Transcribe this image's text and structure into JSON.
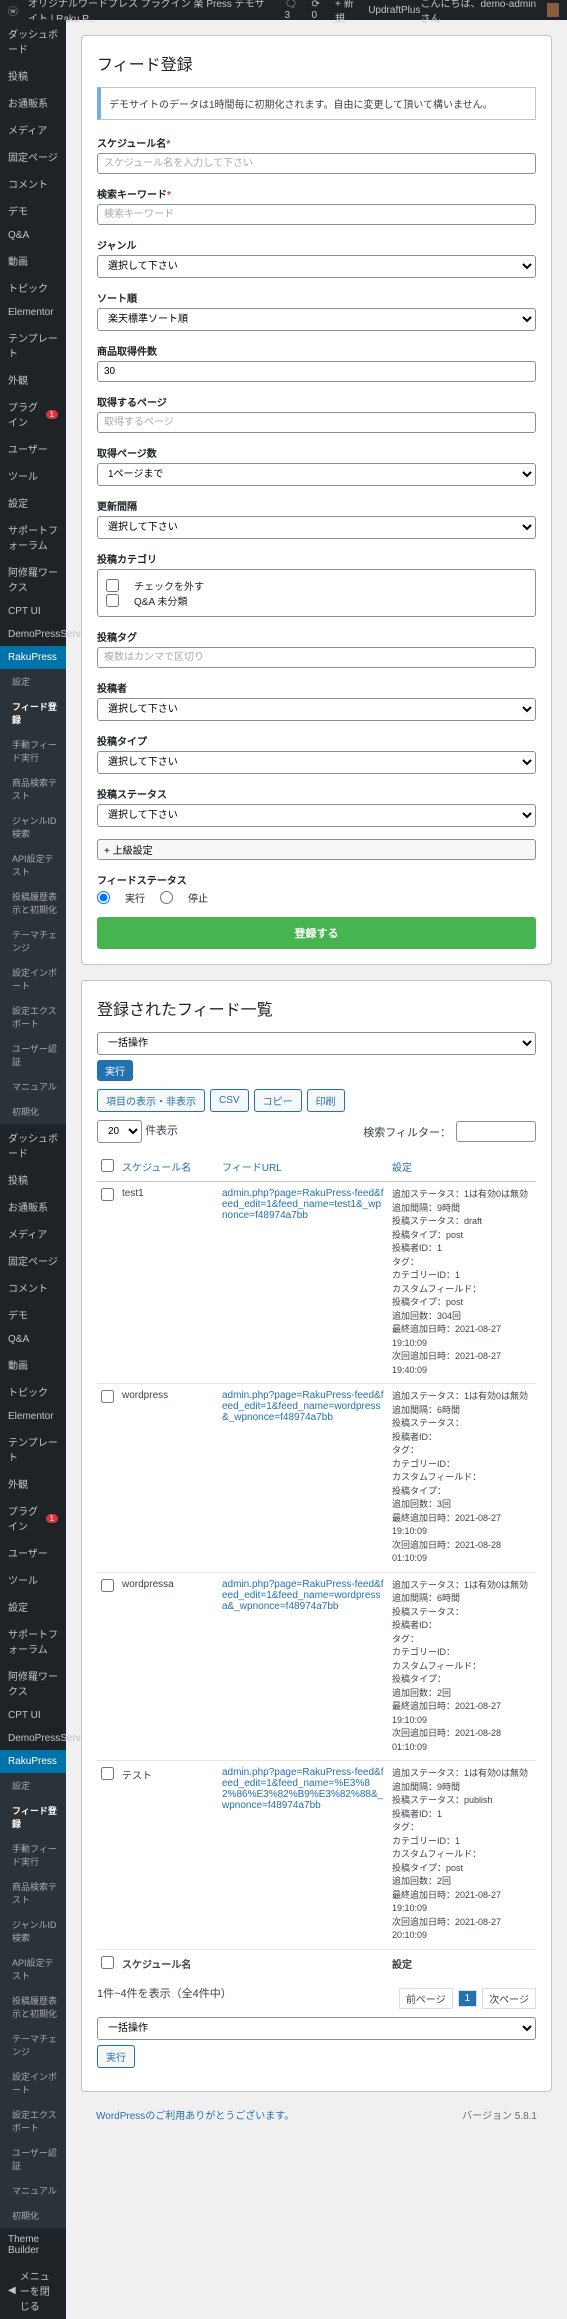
{
  "topbar": {
    "site": "オリジナルワードプレス プラグイン 楽 Press デモサイト | Raku P...",
    "comments": "3",
    "updates": "0",
    "new": "+ 新規",
    "updraft": "UpdraftPlus",
    "greeting": "こんにちは、demo-admin さん"
  },
  "sidebar": [
    {
      "label": "ダッシュボード"
    },
    {
      "label": "投稿"
    },
    {
      "label": "お通販系"
    },
    {
      "label": "メディア"
    },
    {
      "label": "固定ページ"
    },
    {
      "label": "コメント"
    },
    {
      "label": "デモ"
    },
    {
      "label": "Q&A"
    },
    {
      "label": "動画"
    },
    {
      "label": "トピック"
    },
    {
      "label": "Elementor"
    },
    {
      "label": "テンプレート"
    },
    {
      "label": "外観"
    },
    {
      "label": "プラグイン",
      "badge": "1"
    },
    {
      "label": "ユーザー"
    },
    {
      "label": "ツール"
    },
    {
      "label": "設定"
    },
    {
      "label": "サポートフォーラム"
    },
    {
      "label": "阿修羅ワークス"
    },
    {
      "label": "CPT UI"
    },
    {
      "label": "DemoPressServer"
    },
    {
      "label": "RakuPress",
      "current": true
    }
  ],
  "submenu": [
    {
      "label": "設定"
    },
    {
      "label": "フィード登録",
      "active": true
    },
    {
      "label": "手動フィード実行"
    },
    {
      "label": "商品検索テスト"
    },
    {
      "label": "ジャンルID検索"
    },
    {
      "label": "API設定テスト"
    },
    {
      "label": "投稿履歴表示と初期化"
    },
    {
      "label": "テーマチェンジ"
    },
    {
      "label": "設定インポート"
    },
    {
      "label": "設定エクスポート"
    },
    {
      "label": "ユーザー認証"
    },
    {
      "label": "マニュアル"
    },
    {
      "label": "初期化"
    }
  ],
  "sidebar2": [
    {
      "label": "ダッシュボード"
    },
    {
      "label": "投稿"
    },
    {
      "label": "お通販系"
    },
    {
      "label": "メディア"
    },
    {
      "label": "固定ページ"
    },
    {
      "label": "コメント"
    },
    {
      "label": "デモ"
    },
    {
      "label": "Q&A"
    },
    {
      "label": "動画"
    },
    {
      "label": "トピック"
    },
    {
      "label": "Elementor"
    },
    {
      "label": "テンプレート"
    },
    {
      "label": "外観"
    },
    {
      "label": "プラグイン",
      "badge": "1"
    },
    {
      "label": "ユーザー"
    },
    {
      "label": "ツール"
    },
    {
      "label": "設定"
    },
    {
      "label": "サポートフォーラム"
    },
    {
      "label": "阿修羅ワークス"
    },
    {
      "label": "CPT UI"
    },
    {
      "label": "DemoPressServer"
    },
    {
      "label": "RakuPress",
      "current": true
    }
  ],
  "submenu2": [
    {
      "label": "設定"
    },
    {
      "label": "フィード登録",
      "active": true
    },
    {
      "label": "手動フィード実行"
    },
    {
      "label": "商品検索テスト"
    },
    {
      "label": "ジャンルID検索"
    },
    {
      "label": "API設定テスト"
    },
    {
      "label": "投稿履歴表示と初期化"
    },
    {
      "label": "テーマチェンジ"
    },
    {
      "label": "設定インポート"
    },
    {
      "label": "設定エクスポート"
    },
    {
      "label": "ユーザー認証"
    },
    {
      "label": "マニュアル"
    },
    {
      "label": "初期化"
    }
  ],
  "collapse": "メニューを閉じる",
  "themebuilder": "Theme Builder",
  "form": {
    "title": "フィード登録",
    "notice": "デモサイトのデータは1時間毎に初期化されます。自由に変更して頂いて構いません。",
    "schedule_label": "スケジュール名",
    "schedule_ph": "スケジュール名を入力して下さい",
    "keyword_label": "検索キーワード",
    "keyword_ph": "検索キーワード",
    "genre_label": "ジャンル",
    "genre_opt": "選択して下さい",
    "sort_label": "ソート順",
    "sort_opt": "楽天標準ソート順",
    "count_label": "商品取得件数",
    "count_val": "30",
    "page_label": "取得するページ",
    "page_ph": "取得するページ",
    "pagecount_label": "取得ページ数",
    "pagecount_opt": "1ページまで",
    "interval_label": "更新間隔",
    "interval_opt": "選択して下さい",
    "category_label": "投稿カテゴリ",
    "cat_check": "チェックを外す",
    "cat_qa": "Q&A 未分類",
    "tag_label": "投稿タグ",
    "tag_ph": "複数はカンマで区切り",
    "author_label": "投稿者",
    "author_opt": "選択して下さい",
    "type_label": "投稿タイプ",
    "type_opt": "選択して下さい",
    "status_label": "投稿ステータス",
    "status_opt": "選択して下さい",
    "advanced": "+ 上級設定",
    "feed_status": "フィードステータス",
    "run": "実行",
    "stop": "停止",
    "submit": "登録する"
  },
  "list": {
    "title": "登録されたフィード一覧",
    "bulk": "一括操作",
    "apply": "実行",
    "toggle": "項目の表示・非表示",
    "csv": "CSV",
    "copy": "コピー",
    "print": "印刷",
    "per_page": "20",
    "per_page_label": "件表示",
    "search_label": "検索フィルター：",
    "col_name": "スケジュール名",
    "col_url": "フィードURL",
    "col_set": "設定",
    "rows": [
      {
        "name": "test1",
        "url": "admin.php?page=RakuPress-feed&feed_edit=1&feed_name=test1&_wpnonce=f48974a7bb",
        "settings": "追加ステータス：1は有効0は無効\n追加間隔：9時間\n投稿ステータス：draft\n投稿タイプ：post\n投稿者ID：1\nタグ：\nカテゴリーID：1\nカスタムフィールド：\n投稿タイプ：post\n追加回数：304回\n最終追加日時：2021-08-27 19:10:09\n次回追加日時：2021-08-27 19:40:09"
      },
      {
        "name": "wordpress",
        "url": "admin.php?page=RakuPress-feed&feed_edit=1&feed_name=wordpress&_wpnonce=f48974a7bb",
        "settings": "追加ステータス：1は有効0は無効\n追加間隔：6時間\n投稿ステータス：\n投稿者ID：\nタグ：\nカテゴリーID：\nカスタムフィールド：\n投稿タイプ：\n追加回数：3回\n最終追加日時：2021-08-27 19:10:09\n次回追加日時：2021-08-28 01:10:09"
      },
      {
        "name": "wordpressa",
        "url": "admin.php?page=RakuPress-feed&feed_edit=1&feed_name=wordpressa&_wpnonce=f48974a7bb",
        "settings": "追加ステータス：1は有効0は無効\n追加間隔：6時間\n投稿ステータス：\n投稿者ID：\nタグ：\nカテゴリーID：\nカスタムフィールド：\n投稿タイプ：\n追加回数：2回\n最終追加日時：2021-08-27 19:10:09\n次回追加日時：2021-08-28 01:10:09"
      },
      {
        "name": "テスト",
        "url": "admin.php?page=RakuPress-feed&feed_edit=1&feed_name=%E3%82%86%E3%82%B9%E3%82%88&_wpnonce=f48974a7bb",
        "settings": "追加ステータス：1は有効0は無効\n追加間隔：9時間\n投稿ステータス：publish\n投稿者ID：1\nタグ：\nカテゴリーID：1\nカスタムフィールド：\n投稿タイプ：post\n追加回数：2回\n最終追加日時：2021-08-27 19:10:09\n次回追加日時：2021-08-27 20:10:09"
      }
    ],
    "info": "1件~4件を表示（全4件中）",
    "prev": "前ページ",
    "page": "1",
    "next": "次ページ"
  },
  "footer": {
    "thanks": "WordPressのご利用ありがとうございます。",
    "version": "バージョン 5.8.1"
  }
}
